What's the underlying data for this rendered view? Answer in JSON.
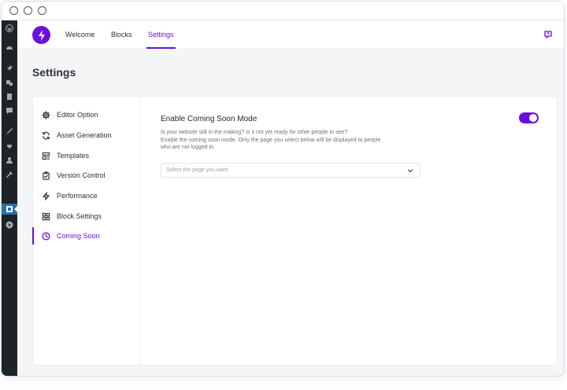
{
  "nav": {
    "tabs": [
      {
        "label": "Welcome"
      },
      {
        "label": "Blocks"
      },
      {
        "label": "Settings"
      }
    ]
  },
  "page": {
    "title": "Settings"
  },
  "sidebar": {
    "items": [
      {
        "label": "Editor Option",
        "icon": "gear-icon"
      },
      {
        "label": "Asset Generation",
        "icon": "refresh-icon"
      },
      {
        "label": "Templates",
        "icon": "template-icon"
      },
      {
        "label": "Version Control",
        "icon": "clipboard-check-icon"
      },
      {
        "label": "Performance",
        "icon": "lightning-icon"
      },
      {
        "label": "Block Settings",
        "icon": "grid-icon"
      },
      {
        "label": "Coming Soon",
        "icon": "clock-icon"
      }
    ]
  },
  "coming_soon": {
    "title": "Enable Coming Soon Mode",
    "desc_line1": "Is your website still in the making? Is it not yet ready for other people to see?",
    "desc_line2": "Enable the coming soon mode. Only the page you select below will be displayed to people",
    "desc_line3": "who are not logged in.",
    "select_placeholder": "Select the page you want",
    "enabled": true
  },
  "colors": {
    "accent": "#6d0ee0",
    "wp_admin_bar": "#1d2327",
    "wp_active": "#2271b1"
  }
}
